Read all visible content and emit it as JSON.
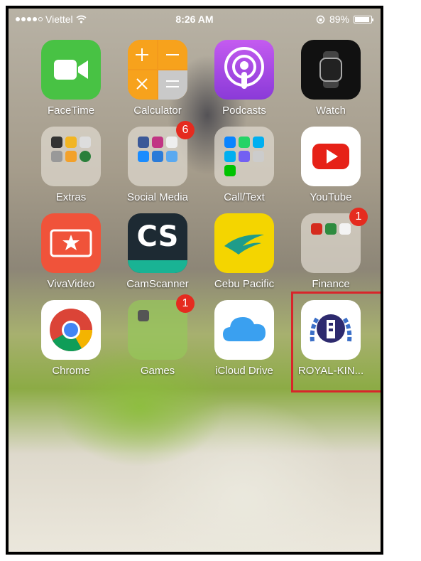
{
  "status_bar": {
    "carrier": "Viettel",
    "time": "8:26 AM",
    "battery": "89%"
  },
  "apps": [
    {
      "label": "FaceTime",
      "icon": "facetime-icon"
    },
    {
      "label": "Calculator",
      "icon": "calculator-icon"
    },
    {
      "label": "Podcasts",
      "icon": "podcasts-icon"
    },
    {
      "label": "Watch",
      "icon": "watch-icon"
    },
    {
      "label": "Extras",
      "icon": "extras-folder-icon"
    },
    {
      "label": "Social Media",
      "icon": "social-media-folder-icon",
      "badge": "6"
    },
    {
      "label": "Call/Text",
      "icon": "call-text-folder-icon"
    },
    {
      "label": "YouTube",
      "icon": "youtube-icon"
    },
    {
      "label": "VivaVideo",
      "icon": "vivavideo-icon"
    },
    {
      "label": "CamScanner",
      "icon": "camscanner-icon"
    },
    {
      "label": "Cebu Pacific",
      "icon": "cebu-pacific-icon"
    },
    {
      "label": "Finance",
      "icon": "finance-folder-icon",
      "badge": "1"
    },
    {
      "label": "Chrome",
      "icon": "chrome-icon"
    },
    {
      "label": "Games",
      "icon": "games-folder-icon",
      "badge": "1"
    },
    {
      "label": "iCloud Drive",
      "icon": "icloud-drive-icon"
    },
    {
      "label": "ROYAL-KIN...",
      "icon": "royal-king-icon"
    }
  ],
  "icon_text": {
    "camscanner": "CS"
  },
  "colors": {
    "highlight": "#d8252a",
    "badge": "#e52b1f"
  }
}
